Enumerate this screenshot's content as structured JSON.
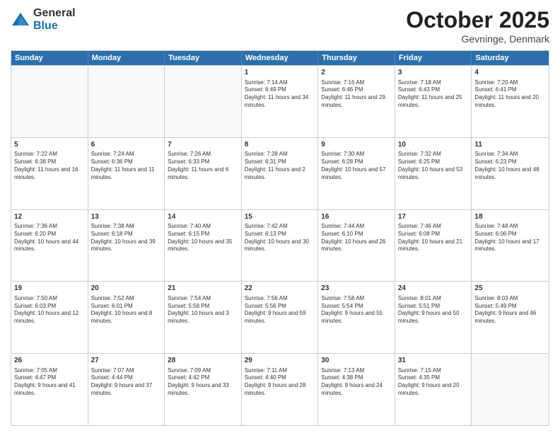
{
  "logo": {
    "general": "General",
    "blue": "Blue"
  },
  "title": "October 2025",
  "location": "Gevninge, Denmark",
  "days_of_week": [
    "Sunday",
    "Monday",
    "Tuesday",
    "Wednesday",
    "Thursday",
    "Friday",
    "Saturday"
  ],
  "weeks": [
    [
      {
        "day": "",
        "text": ""
      },
      {
        "day": "",
        "text": ""
      },
      {
        "day": "",
        "text": ""
      },
      {
        "day": "1",
        "text": "Sunrise: 7:14 AM\nSunset: 6:49 PM\nDaylight: 11 hours and 34 minutes."
      },
      {
        "day": "2",
        "text": "Sunrise: 7:16 AM\nSunset: 6:46 PM\nDaylight: 11 hours and 29 minutes."
      },
      {
        "day": "3",
        "text": "Sunrise: 7:18 AM\nSunset: 6:43 PM\nDaylight: 11 hours and 25 minutes."
      },
      {
        "day": "4",
        "text": "Sunrise: 7:20 AM\nSunset: 6:41 PM\nDaylight: 11 hours and 20 minutes."
      }
    ],
    [
      {
        "day": "5",
        "text": "Sunrise: 7:22 AM\nSunset: 6:38 PM\nDaylight: 11 hours and 16 minutes."
      },
      {
        "day": "6",
        "text": "Sunrise: 7:24 AM\nSunset: 6:36 PM\nDaylight: 11 hours and 11 minutes."
      },
      {
        "day": "7",
        "text": "Sunrise: 7:26 AM\nSunset: 6:33 PM\nDaylight: 11 hours and 6 minutes."
      },
      {
        "day": "8",
        "text": "Sunrise: 7:28 AM\nSunset: 6:31 PM\nDaylight: 11 hours and 2 minutes."
      },
      {
        "day": "9",
        "text": "Sunrise: 7:30 AM\nSunset: 6:28 PM\nDaylight: 10 hours and 57 minutes."
      },
      {
        "day": "10",
        "text": "Sunrise: 7:32 AM\nSunset: 6:25 PM\nDaylight: 10 hours and 53 minutes."
      },
      {
        "day": "11",
        "text": "Sunrise: 7:34 AM\nSunset: 6:23 PM\nDaylight: 10 hours and 48 minutes."
      }
    ],
    [
      {
        "day": "12",
        "text": "Sunrise: 7:36 AM\nSunset: 6:20 PM\nDaylight: 10 hours and 44 minutes."
      },
      {
        "day": "13",
        "text": "Sunrise: 7:38 AM\nSunset: 6:18 PM\nDaylight: 10 hours and 39 minutes."
      },
      {
        "day": "14",
        "text": "Sunrise: 7:40 AM\nSunset: 6:15 PM\nDaylight: 10 hours and 35 minutes."
      },
      {
        "day": "15",
        "text": "Sunrise: 7:42 AM\nSunset: 6:13 PM\nDaylight: 10 hours and 30 minutes."
      },
      {
        "day": "16",
        "text": "Sunrise: 7:44 AM\nSunset: 6:10 PM\nDaylight: 10 hours and 26 minutes."
      },
      {
        "day": "17",
        "text": "Sunrise: 7:46 AM\nSunset: 6:08 PM\nDaylight: 10 hours and 21 minutes."
      },
      {
        "day": "18",
        "text": "Sunrise: 7:48 AM\nSunset: 6:06 PM\nDaylight: 10 hours and 17 minutes."
      }
    ],
    [
      {
        "day": "19",
        "text": "Sunrise: 7:50 AM\nSunset: 6:03 PM\nDaylight: 10 hours and 12 minutes."
      },
      {
        "day": "20",
        "text": "Sunrise: 7:52 AM\nSunset: 6:01 PM\nDaylight: 10 hours and 8 minutes."
      },
      {
        "day": "21",
        "text": "Sunrise: 7:54 AM\nSunset: 5:58 PM\nDaylight: 10 hours and 3 minutes."
      },
      {
        "day": "22",
        "text": "Sunrise: 7:56 AM\nSunset: 5:56 PM\nDaylight: 9 hours and 59 minutes."
      },
      {
        "day": "23",
        "text": "Sunrise: 7:58 AM\nSunset: 5:54 PM\nDaylight: 9 hours and 55 minutes."
      },
      {
        "day": "24",
        "text": "Sunrise: 8:01 AM\nSunset: 5:51 PM\nDaylight: 9 hours and 50 minutes."
      },
      {
        "day": "25",
        "text": "Sunrise: 8:03 AM\nSunset: 5:49 PM\nDaylight: 9 hours and 46 minutes."
      }
    ],
    [
      {
        "day": "26",
        "text": "Sunrise: 7:05 AM\nSunset: 4:47 PM\nDaylight: 9 hours and 41 minutes."
      },
      {
        "day": "27",
        "text": "Sunrise: 7:07 AM\nSunset: 4:44 PM\nDaylight: 9 hours and 37 minutes."
      },
      {
        "day": "28",
        "text": "Sunrise: 7:09 AM\nSunset: 4:42 PM\nDaylight: 9 hours and 33 minutes."
      },
      {
        "day": "29",
        "text": "Sunrise: 7:11 AM\nSunset: 4:40 PM\nDaylight: 9 hours and 28 minutes."
      },
      {
        "day": "30",
        "text": "Sunrise: 7:13 AM\nSunset: 4:38 PM\nDaylight: 9 hours and 24 minutes."
      },
      {
        "day": "31",
        "text": "Sunrise: 7:15 AM\nSunset: 4:35 PM\nDaylight: 9 hours and 20 minutes."
      },
      {
        "day": "",
        "text": ""
      }
    ]
  ]
}
